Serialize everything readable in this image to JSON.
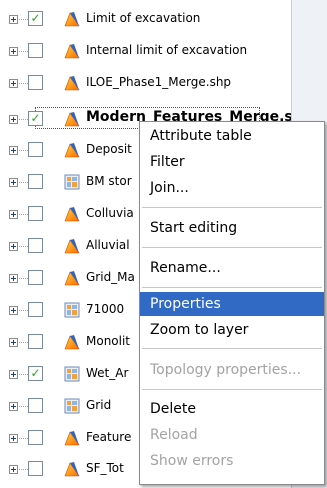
{
  "layers": [
    {
      "label": "Limit of excavation",
      "checked": true,
      "icon": "polygon-layer-icon"
    },
    {
      "label": "Internal limit of excavation",
      "checked": false,
      "icon": "polygon-layer-icon"
    },
    {
      "label": "ILOE_Phase1_Merge.shp",
      "checked": false,
      "icon": "polygon-layer-icon"
    },
    {
      "label": "Modern_Features_Merge.s",
      "checked": true,
      "icon": "polygon-layer-icon",
      "selected": true
    },
    {
      "label": "Deposit",
      "checked": false,
      "icon": "polygon-layer-icon"
    },
    {
      "label": "BM stor",
      "checked": false,
      "icon": "raster-layer-icon"
    },
    {
      "label": "Colluvia",
      "checked": false,
      "icon": "polygon-layer-icon"
    },
    {
      "label": "Alluvial",
      "checked": false,
      "icon": "polygon-layer-icon"
    },
    {
      "label": "Grid_Ma",
      "checked": false,
      "icon": "polygon-layer-icon"
    },
    {
      "label": "71000",
      "checked": false,
      "icon": "raster-layer-icon"
    },
    {
      "label": "Monolit",
      "checked": false,
      "icon": "polygon-layer-icon"
    },
    {
      "label": "Wet_Ar",
      "checked": true,
      "icon": "raster-layer-icon"
    },
    {
      "label": "Grid",
      "checked": false,
      "icon": "raster-layer-icon"
    },
    {
      "label": "Feature",
      "checked": false,
      "icon": "polygon-layer-icon"
    },
    {
      "label": "SF_Tot",
      "checked": false,
      "icon": "polygon-layer-icon"
    }
  ],
  "context_menu": {
    "attribute_table": "Attribute table",
    "filter": "Filter",
    "join": "Join...",
    "start_editing": "Start editing",
    "rename": "Rename...",
    "properties": "Properties",
    "zoom_to_layer": "Zoom to layer",
    "topology_properties": "Topology properties...",
    "delete": "Delete",
    "reload": "Reload",
    "show_errors": "Show errors"
  },
  "colors": {
    "highlight": "#316ac5",
    "disabled_text": "#a3a3a3",
    "check_mark": "#2aa02a"
  }
}
